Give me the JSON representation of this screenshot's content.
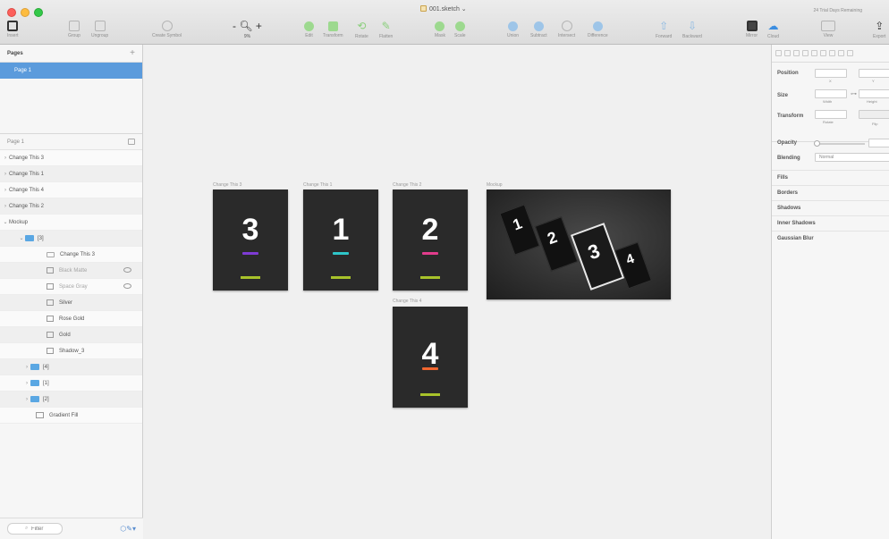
{
  "window": {
    "title": "001.sketch",
    "trial_text": "24 Trial Days Remaining"
  },
  "toolbar": {
    "insert": "Insert",
    "group": "Group",
    "ungroup": "Ungroup",
    "create_symbol": "Create Symbol",
    "zoom_value": "9%",
    "edit": "Edit",
    "transform": "Transform",
    "rotate": "Rotate",
    "flatten": "Flatten",
    "mask": "Mask",
    "scale": "Scale",
    "union": "Union",
    "subtract": "Subtract",
    "intersect": "Intersect",
    "difference": "Difference",
    "forward": "Forward",
    "backward": "Backward",
    "mirror": "Mirror",
    "cloud": "Cloud",
    "view": "View",
    "export": "Export"
  },
  "sidebar": {
    "pages_title": "Pages",
    "pages_add": "+",
    "selected_page": "Page 1",
    "layers_page": "Page 1",
    "layers": [
      {
        "label": "Change This 3"
      },
      {
        "label": "Change This 1"
      },
      {
        "label": "Change This 4"
      },
      {
        "label": "Change This 2"
      },
      {
        "label": "Mockup"
      },
      {
        "label": "[3]"
      },
      {
        "label": "Change This 3"
      },
      {
        "label": "Black Matte"
      },
      {
        "label": "Space Gray"
      },
      {
        "label": "Silver"
      },
      {
        "label": "Rose Gold"
      },
      {
        "label": "Gold"
      },
      {
        "label": "Shadow_3"
      },
      {
        "label": "[4]"
      },
      {
        "label": "[1]"
      },
      {
        "label": "[2]"
      },
      {
        "label": "Gradient Fill"
      }
    ],
    "filter_placeholder": "Filter"
  },
  "canvas": {
    "artboards": [
      {
        "label": "Change This 3",
        "digit": "3",
        "accent": "#7e3bd4"
      },
      {
        "label": "Change This 1",
        "digit": "1",
        "accent": "#2ec6c9"
      },
      {
        "label": "Change This 2",
        "digit": "2",
        "accent": "#e23c8c"
      },
      {
        "label": "Change This 4",
        "digit": "4",
        "accent": "#f2662f"
      }
    ],
    "mockup_label": "Mockup",
    "mockup_digits": [
      "1",
      "2",
      "3",
      "4"
    ],
    "green_bar_color": "#a8c22a"
  },
  "inspector": {
    "position": "Position",
    "x": "X",
    "y": "Y",
    "size": "Size",
    "width": "Width",
    "height": "Height",
    "transform": "Transform",
    "rotate": "Rotate",
    "flip": "Flip",
    "opacity": "Opacity",
    "blending": "Blending",
    "blending_value": "Normal",
    "fills": "Fills",
    "borders": "Borders",
    "shadows": "Shadows",
    "inner_shadows": "Inner Shadows",
    "gaussian_blur": "Gaussian Blur"
  }
}
